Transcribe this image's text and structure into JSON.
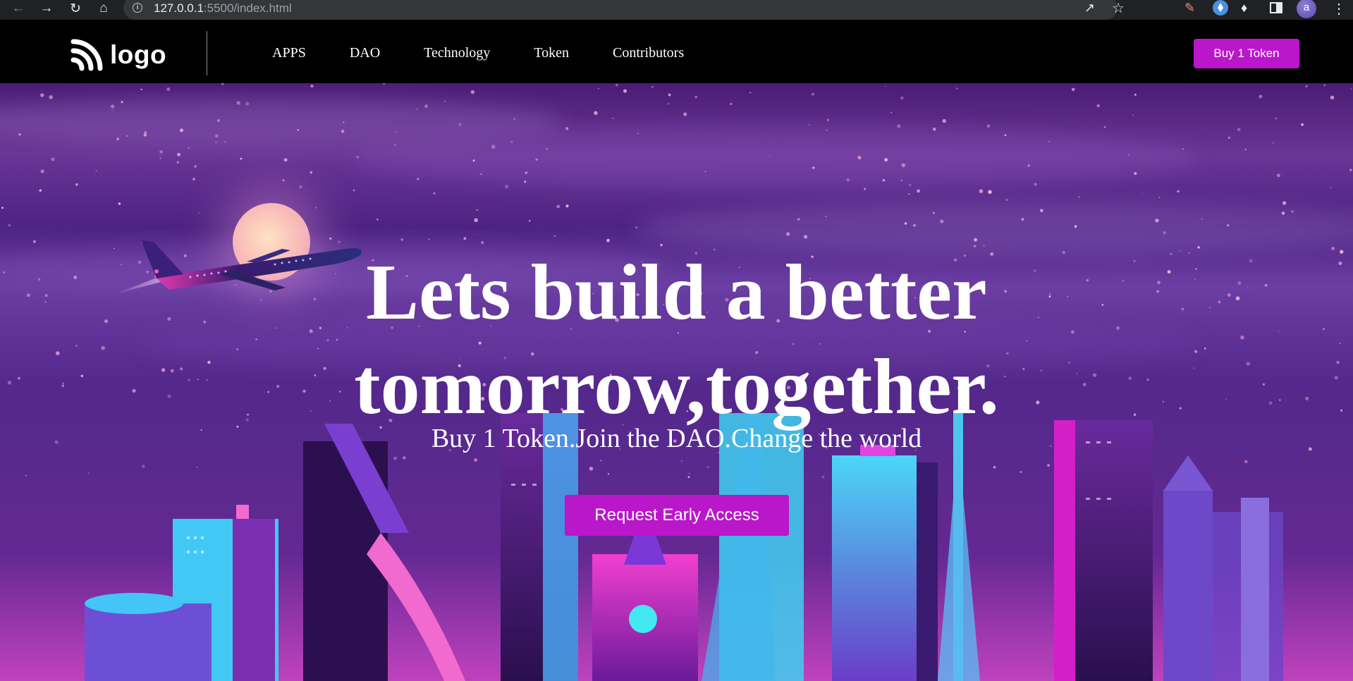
{
  "browser": {
    "url_host": "127.0.0.1",
    "url_rest": ":5500/index.html",
    "avatar_letter": "a"
  },
  "site": {
    "logo_text": "logo",
    "nav": [
      "APPS",
      "DAO",
      "Technology",
      "Token",
      "Contributors"
    ],
    "buy_button": "Buy 1 Token"
  },
  "hero": {
    "title_line1": "Lets build a better",
    "title_line2": "tomorrow,together.",
    "subtitle": "Buy 1 Token.Join the DAO.Change the world",
    "cta": "Request Early Access"
  },
  "colors": {
    "accent": "#b917c9",
    "nav_bg": "#000000",
    "chrome_bg": "#202124"
  }
}
